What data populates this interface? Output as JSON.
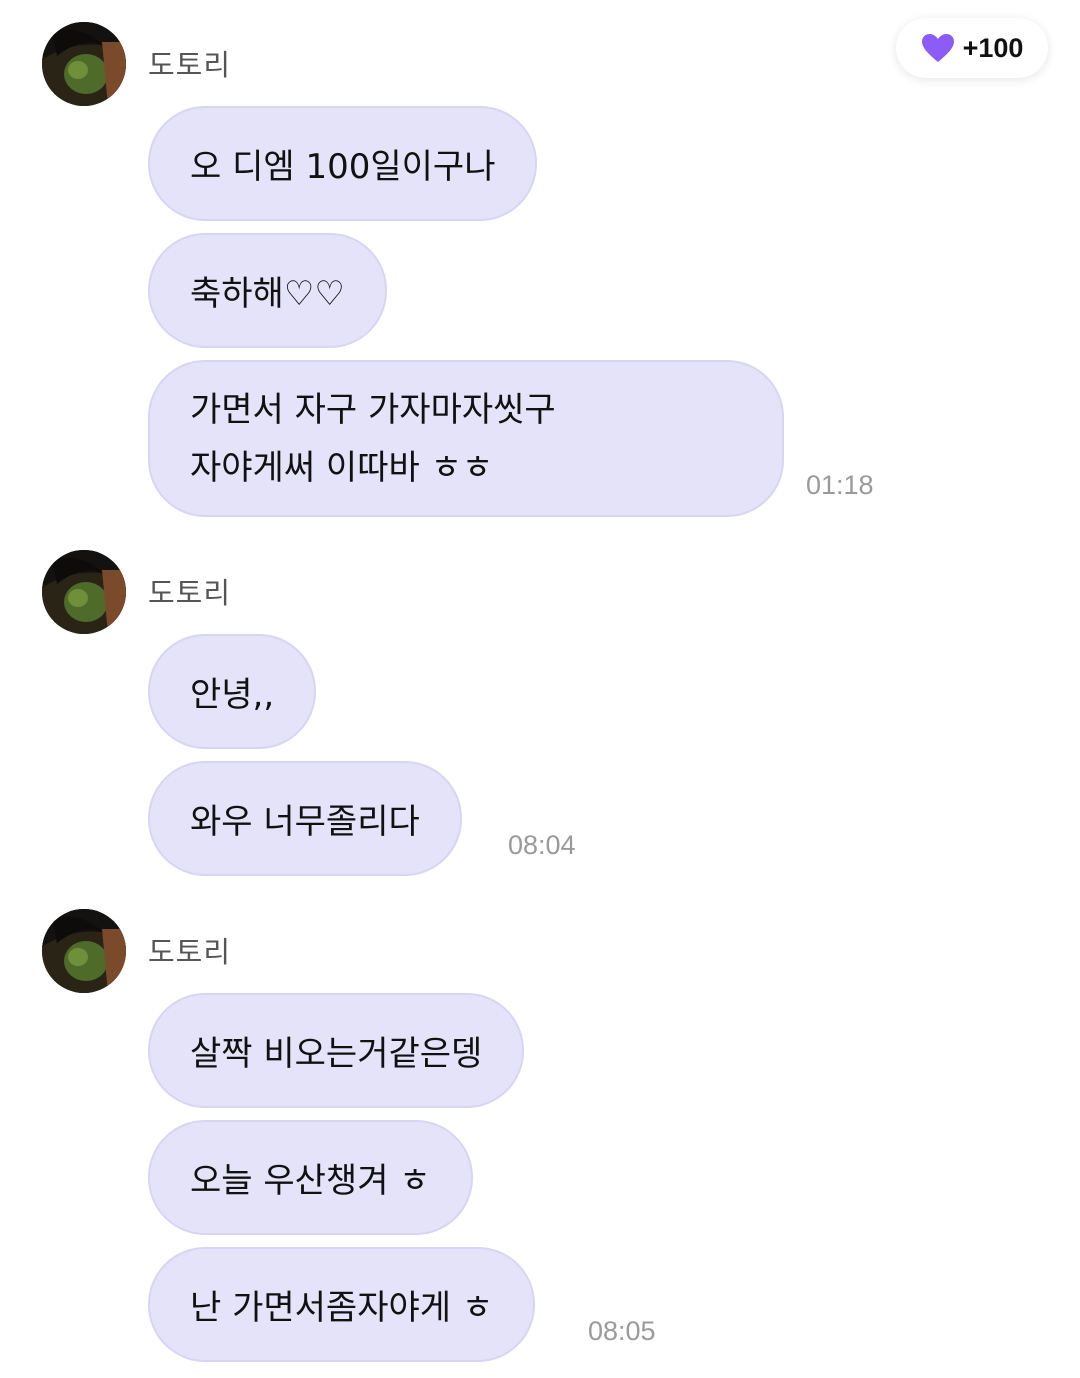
{
  "reward_badge": {
    "icon": "purple-heart-icon",
    "label": "+100",
    "color": "#8b5cf6"
  },
  "messages_groups": [
    {
      "sender": "도토리",
      "messages": [
        "오 디엠 100일이구나",
        "축하해♡♡",
        "가면서 자구 가자마자씻구\n자야게써 이따바 ㅎㅎ"
      ],
      "time": "01:18"
    },
    {
      "sender": "도토리",
      "messages": [
        "안녕,,",
        "와우 너무졸리다"
      ],
      "time": "08:04"
    },
    {
      "sender": "도토리",
      "messages": [
        "살짝 비오는거같은뎅",
        "오늘 우산챙겨 ㅎ",
        "난 가면서좀자야게 ㅎ"
      ],
      "time": "08:05"
    }
  ],
  "colors": {
    "bubble_bg": "#e5e3fa",
    "bubble_border": "#d8d5f3",
    "sender_text": "#555555",
    "time_text": "#9a9a9a"
  }
}
